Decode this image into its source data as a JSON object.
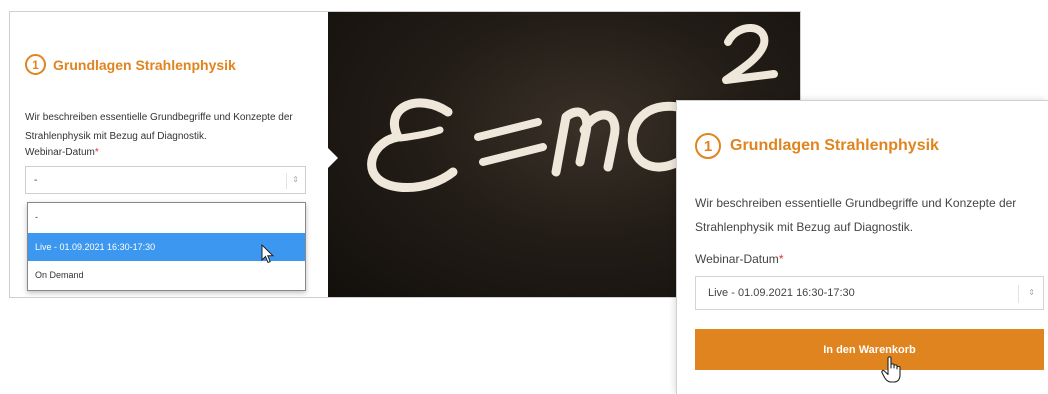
{
  "course": {
    "number": "1",
    "title": "Grundlagen Strahlenphysik",
    "description": "Wir beschreiben essentielle Grundbegriffe und Konzepte der Strahlenphysik mit Bezug auf Diagnostik.",
    "date_label": "Webinar-Datum",
    "required_mark": "*"
  },
  "left_select": {
    "value": "-",
    "arrow": "⇕"
  },
  "dropdown": {
    "options": [
      "-",
      "Live - 01.09.2021 16:30-17:30",
      "On Demand"
    ],
    "highlighted_index": 1
  },
  "right_select": {
    "value": "Live - 01.09.2021 16:30-17:30",
    "arrow": "⇕"
  },
  "cart_button": {
    "label": "In den Warenkorb"
  },
  "colors": {
    "accent": "#e0841f",
    "highlight": "#3b97f0",
    "required": "#dd3333"
  }
}
